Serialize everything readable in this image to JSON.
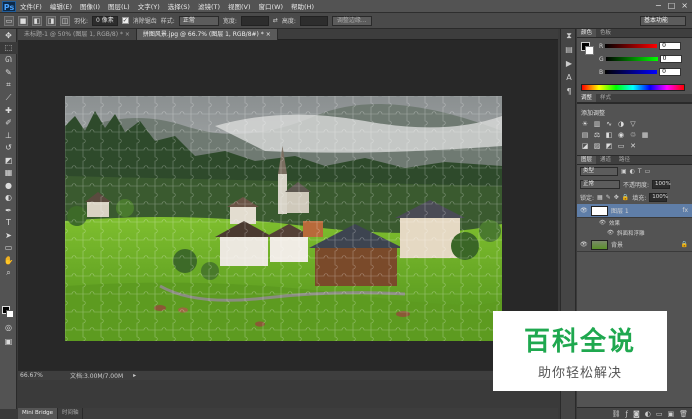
{
  "app": {
    "logo": "Ps",
    "menu": [
      "文件(F)",
      "编辑(E)",
      "图像(I)",
      "图层(L)",
      "文字(Y)",
      "选择(S)",
      "滤镜(T)",
      "视图(V)",
      "窗口(W)",
      "帮助(H)"
    ],
    "window_controls": [
      "−",
      "□",
      "×"
    ]
  },
  "options": {
    "feather_label": "羽化:",
    "feather_value": "0 像素",
    "antialias_label": "消除锯齿",
    "style_label": "样式:",
    "style_value": "正常",
    "width_label": "宽度:",
    "height_label": "高度:",
    "refine_button": "调整边缘...",
    "workspace": "基本功能"
  },
  "tabs": [
    {
      "label": "未标题-1 @ 50% (图层 1, RGB/8) *  ×"
    },
    {
      "label": "拼图风景.jpg @ 66.7% (图层 1, RGB/8#) *  ×"
    }
  ],
  "status": {
    "zoom": "66.67%",
    "doc_info": "文档:3.00M/7.00M"
  },
  "bottom_tabs": [
    "Mini Bridge",
    "时间轴"
  ],
  "panels": {
    "color_tabs": [
      "颜色",
      "色板"
    ],
    "channels": [
      {
        "label": "R",
        "value": "0"
      },
      {
        "label": "G",
        "value": "0"
      },
      {
        "label": "B",
        "value": "0"
      }
    ],
    "adjust_tabs": [
      "调整",
      "样式"
    ],
    "adjust_title": "添加调整",
    "layers_tabs": [
      "图层",
      "通道",
      "路径"
    ],
    "kind_label": "类型",
    "blend_mode": "正常",
    "opacity_label": "不透明度:",
    "opacity_value": "100%",
    "lock_label": "锁定:",
    "fill_label": "填充:",
    "fill_value": "100%",
    "layers": [
      {
        "name": "图层 1",
        "fx": "fx"
      },
      {
        "name": "背景",
        "lock": "🔒"
      }
    ],
    "effects_label": "效果",
    "effect_item": "斜面和浮雕"
  },
  "watermark": {
    "title": "百科全说",
    "subtitle": "助你轻松解决"
  },
  "colors": {
    "menubar": "#535353",
    "canvas_bg": "#282828",
    "layer_selected": "#5f7ea8",
    "watermark_green": "#1fa84f"
  }
}
